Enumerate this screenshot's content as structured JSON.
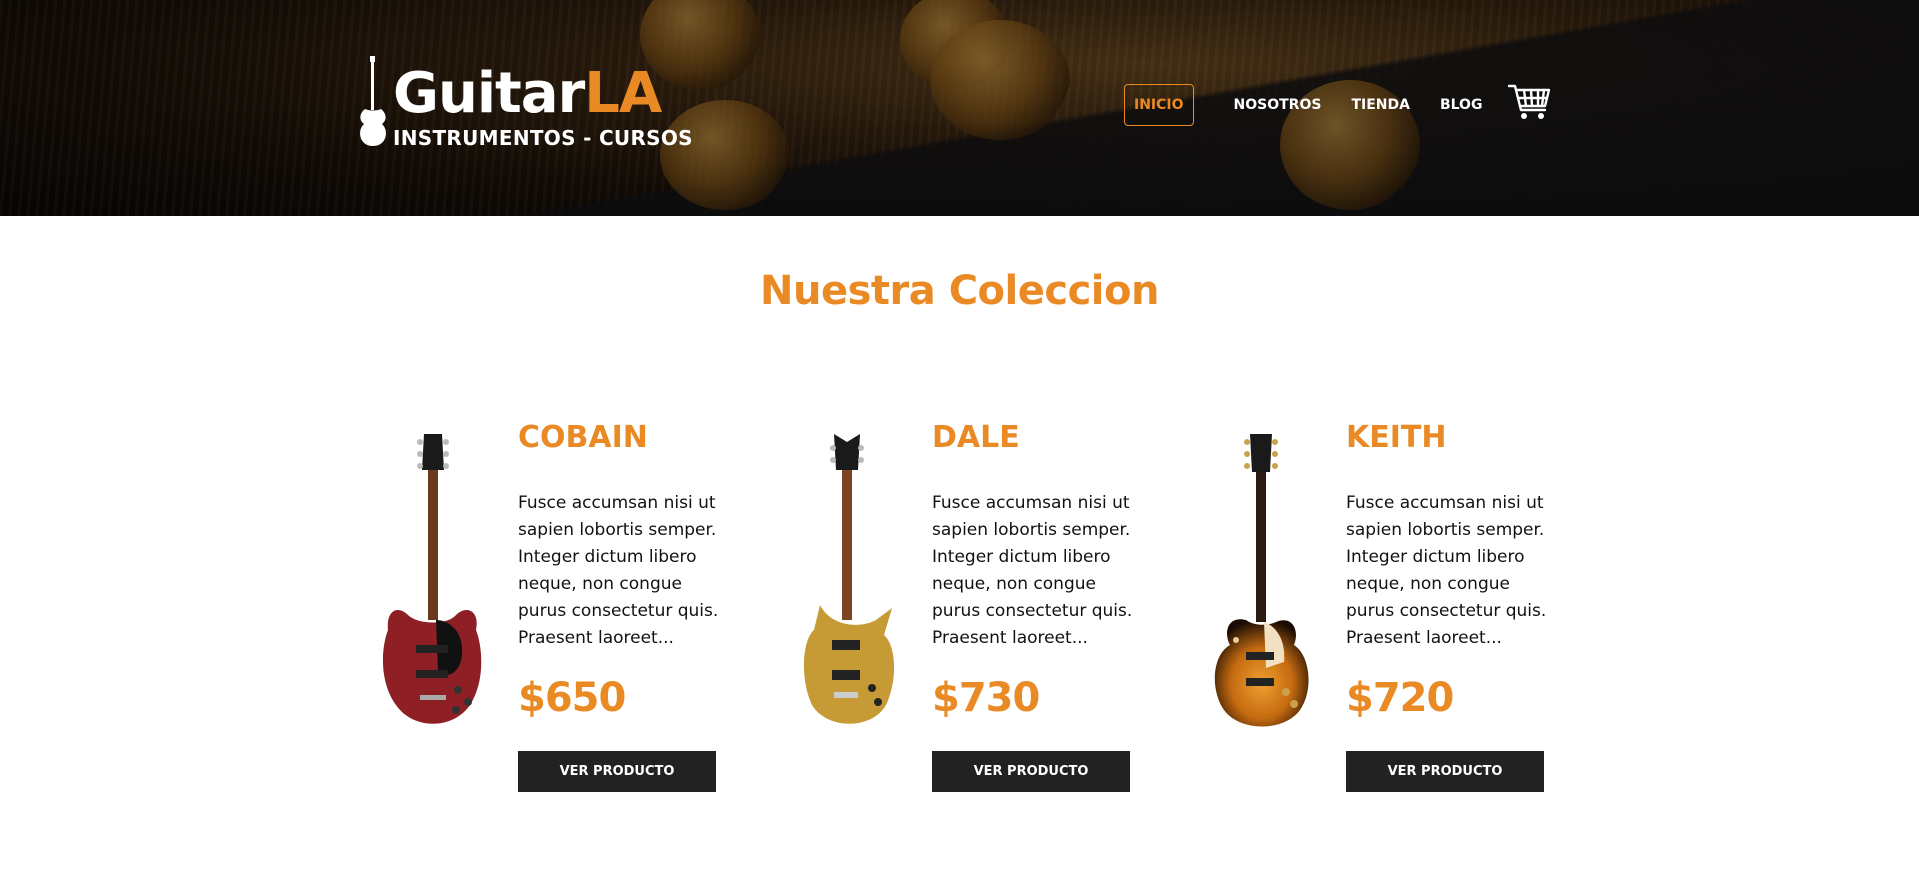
{
  "header": {
    "logo": {
      "word_white": "Guitar",
      "word_orange": "LA",
      "subtitle": "INSTRUMENTOS - CURSOS"
    },
    "nav": [
      {
        "label": "INICIO",
        "active": true
      },
      {
        "label": "NOSOTROS",
        "active": false
      },
      {
        "label": "TIENDA",
        "active": false
      },
      {
        "label": "BLOG",
        "active": false
      }
    ],
    "cart_icon": "shopping-cart-icon"
  },
  "main": {
    "title": "Nuestra Coleccion",
    "products": [
      {
        "name": "COBAIN",
        "description": "Fusce accumsan nisi ut sapien lobortis semper. Integer dictum libero neque, non congue purus consectetur quis. Praesent laoreet...",
        "price": "$650",
        "button": "VER PRODUCTO",
        "body_color": "#8e1f25"
      },
      {
        "name": "DALE",
        "description": "Fusce accumsan nisi ut sapien lobortis semper. Integer dictum libero neque, non congue purus consectetur quis. Praesent laoreet...",
        "price": "$730",
        "button": "VER PRODUCTO",
        "body_color": "#c69a34"
      },
      {
        "name": "KEITH",
        "description": "Fusce accumsan nisi ut sapien lobortis semper. Integer dictum libero neque, non congue purus consectetur quis. Praesent laoreet...",
        "price": "$720",
        "button": "VER PRODUCTO",
        "body_color": "#c46a10"
      }
    ]
  },
  "colors": {
    "accent": "#e98a24",
    "button_bg": "#222222"
  }
}
